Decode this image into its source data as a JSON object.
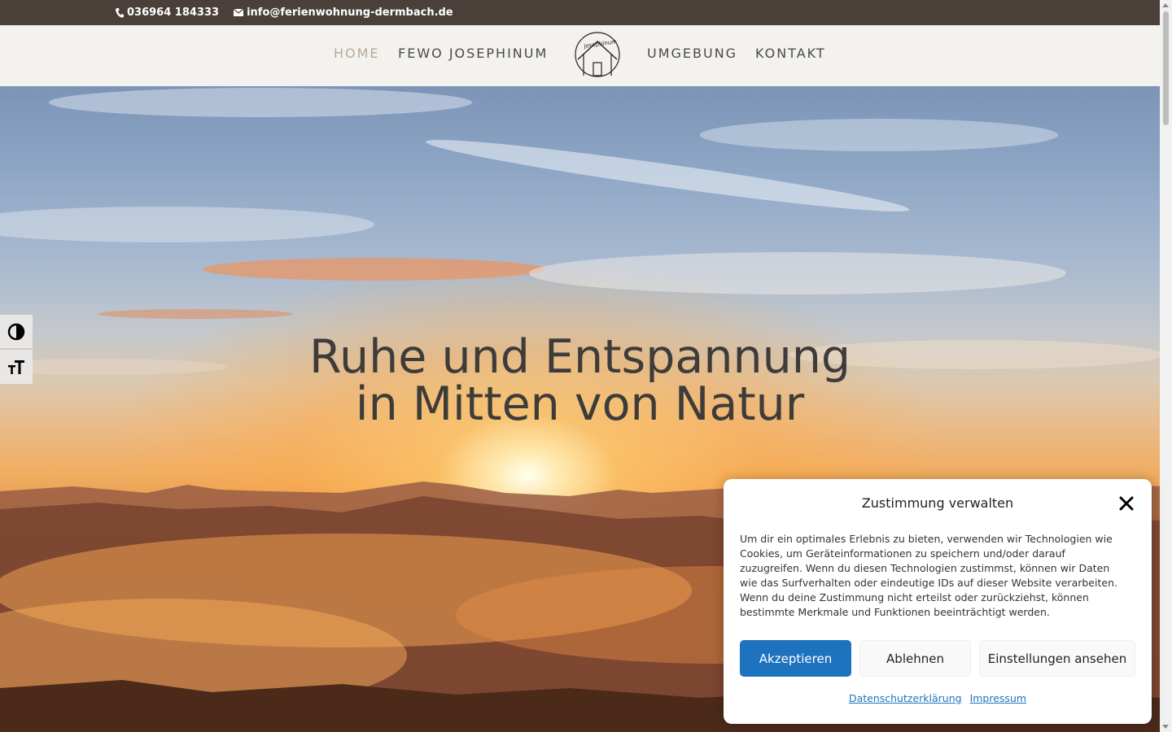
{
  "topbar": {
    "phone": "036964 184333",
    "email": "info@ferienwohnung-dermbach.de"
  },
  "nav": {
    "items": [
      {
        "label": "Home",
        "active": true
      },
      {
        "label": "FeWo Josephinum",
        "active": false
      },
      {
        "label": "Umgebung",
        "active": false
      },
      {
        "label": "Kontakt",
        "active": false
      }
    ],
    "logo_text": "josephinum"
  },
  "hero": {
    "title_line1": "Ruhe und Entspannung",
    "title_line2": "in Mitten von Natur"
  },
  "a11y": {
    "contrast_icon": "contrast-icon",
    "fontsize_icon": "font-size-icon"
  },
  "consent": {
    "title": "Zustimmung verwalten",
    "text": "Um dir ein optimales Erlebnis zu bieten, verwenden wir Technologien wie Cookies, um Geräteinformationen zu speichern und/oder darauf zuzugreifen. Wenn du diesen Technologien zustimmst, können wir Daten wie das Surfverhalten oder eindeutige IDs auf dieser Website verarbeiten. Wenn du deine Zustimmung nicht erteilst oder zurückziehst, können bestimmte Merkmale und Funktionen beeinträchtigt werden.",
    "accept": "Akzeptieren",
    "deny": "Ablehnen",
    "settings": "Einstellungen ansehen",
    "privacy_link": "Datenschutzerklärung",
    "imprint_link": "Impressum"
  },
  "colors": {
    "topbar_bg": "#4a4039",
    "header_bg": "#f4f2ee",
    "nav_active": "#b8a999",
    "accent_button": "#1e73be"
  }
}
